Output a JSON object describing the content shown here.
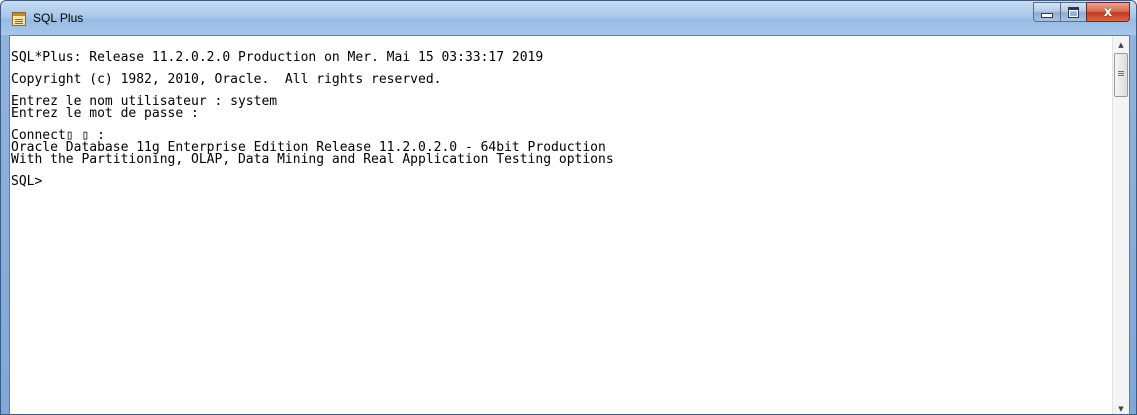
{
  "window": {
    "title": "SQL Plus",
    "app_icon": "sqlplus-app-icon",
    "buttons": {
      "minimize_icon": "minimize-icon",
      "maximize_icon": "maximize-icon",
      "close_glyph": "x"
    }
  },
  "console": {
    "lines": [
      "SQL*Plus: Release 11.2.0.2.0 Production on Mer. Mai 15 03:33:17 2019",
      "Copyright (c) 1982, 2010, Oracle.  All rights reserved.",
      "Entrez le nom utilisateur : system",
      "Entrez le mot de passe :",
      "Connect▯ ▯ :",
      "Oracle Database 11g Enterprise Edition Release 11.2.0.2.0 - 64bit Production",
      "With the Partitioning, OLAP, Data Mining and Real Application Testing options",
      "SQL>"
    ]
  },
  "scrollbar": {
    "up_glyph": "▲",
    "down_glyph": "▼"
  },
  "colors": {
    "titlebar": "#a9c8ea",
    "close_button": "#c23b1d",
    "console_background": "#ffffff",
    "console_text": "#000000"
  }
}
